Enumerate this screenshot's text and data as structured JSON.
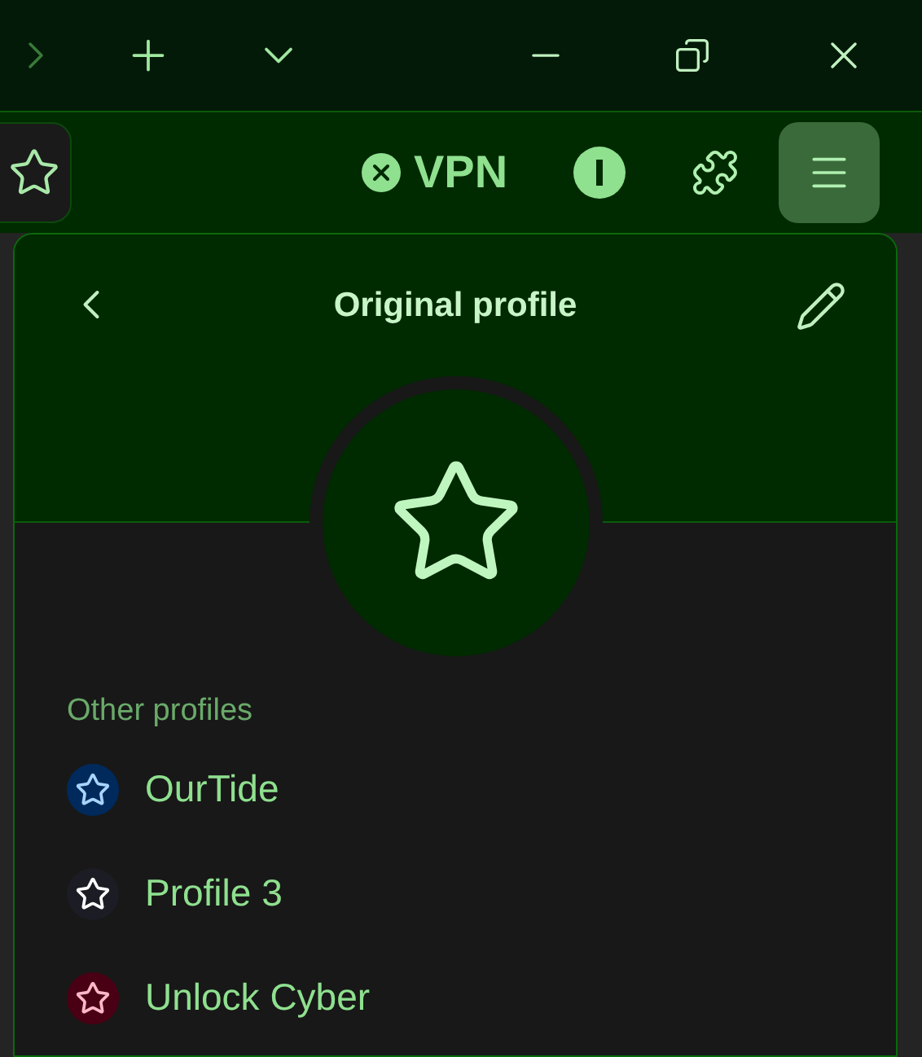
{
  "toolbar": {
    "vpn_label": "VPN"
  },
  "popup": {
    "title": "Original profile",
    "section_title": "Other profiles",
    "profiles": [
      {
        "name": "OurTide",
        "color": "#002a5c"
      },
      {
        "name": "Profile 3",
        "color": "#1c1c24"
      },
      {
        "name": "Unlock Cyber",
        "color": "#4a0014"
      }
    ]
  }
}
